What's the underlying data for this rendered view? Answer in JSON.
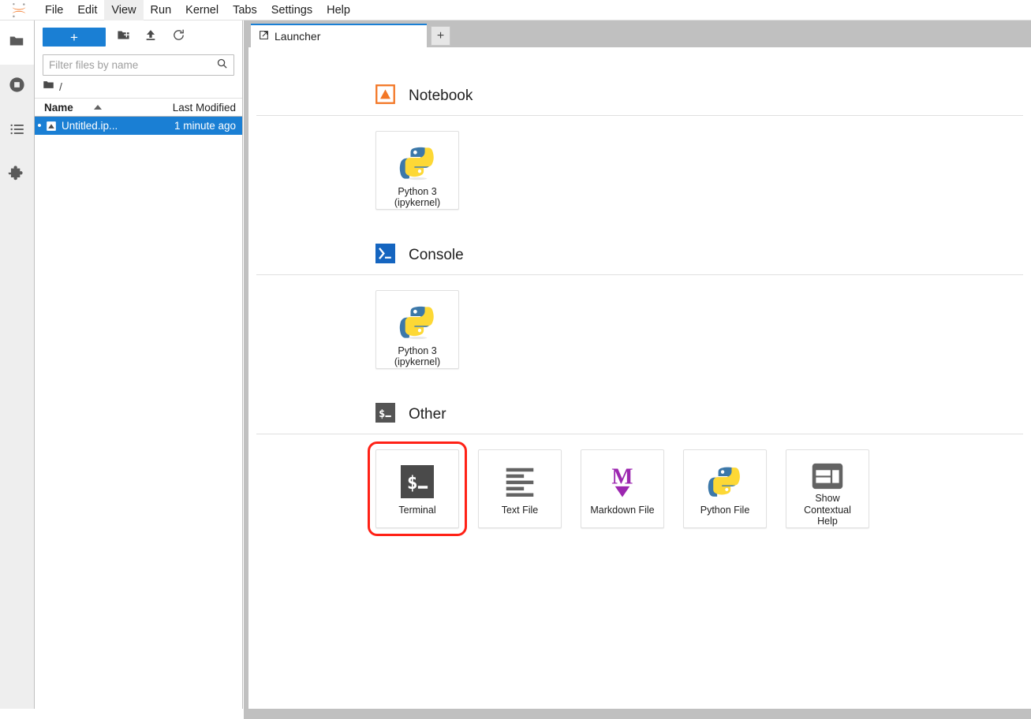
{
  "app": {
    "logo_icon": "jupyter-logo",
    "accent_blue": "#1a7fd4",
    "highlight_red": "#ff2116"
  },
  "menubar": {
    "items": [
      {
        "label": "File",
        "active": false
      },
      {
        "label": "Edit",
        "active": false
      },
      {
        "label": "View",
        "active": true
      },
      {
        "label": "Run",
        "active": false
      },
      {
        "label": "Kernel",
        "active": false
      },
      {
        "label": "Tabs",
        "active": false
      },
      {
        "label": "Settings",
        "active": false
      },
      {
        "label": "Help",
        "active": false
      }
    ]
  },
  "activitybar": {
    "items": [
      {
        "name": "file-browser",
        "icon": "folder-icon",
        "selected": true
      },
      {
        "name": "running-terminals-kernels",
        "icon": "stop-circle-icon",
        "selected": false
      },
      {
        "name": "table-of-contents",
        "icon": "list-icon",
        "selected": false
      },
      {
        "name": "extension-manager",
        "icon": "puzzle-icon",
        "selected": false
      }
    ]
  },
  "filebrowser": {
    "toolbar": {
      "new_launcher_label": "+",
      "new_folder_icon": "new-folder-icon",
      "upload_icon": "upload-icon",
      "refresh_icon": "refresh-icon"
    },
    "filter": {
      "placeholder": "Filter files by name",
      "value": "",
      "icon": "search-icon"
    },
    "breadcrumb": {
      "home_icon": "folder-icon",
      "path": "/"
    },
    "columns": [
      "Name",
      "Last Modified"
    ],
    "sort": {
      "column": "Name",
      "direction": "ascending",
      "icon": "caret-up-icon"
    },
    "rows": [
      {
        "name": "Untitled.ip...",
        "modified": "1 minute ago",
        "icon": "notebook-icon",
        "selected": true,
        "unsaved_dot": "•"
      }
    ]
  },
  "main": {
    "tabs": [
      {
        "label": "Launcher",
        "icon": "launcher-icon",
        "active": true
      }
    ],
    "add_tab_label": "+"
  },
  "launcher": {
    "sections": [
      {
        "title": "Notebook",
        "icon": "notebook-section-icon",
        "cards": [
          {
            "label": "Python 3\n(ipykernel)",
            "label_lines": [
              "Python 3",
              "(ipykernel)"
            ],
            "icon": "python-logo-icon",
            "highlighted": false
          }
        ]
      },
      {
        "title": "Console",
        "icon": "console-section-icon",
        "cards": [
          {
            "label": "Python 3\n(ipykernel)",
            "label_lines": [
              "Python 3",
              "(ipykernel)"
            ],
            "icon": "python-logo-icon",
            "highlighted": false
          }
        ]
      },
      {
        "title": "Other",
        "icon": "terminal-section-icon",
        "cards": [
          {
            "label": "Terminal",
            "label_lines": [
              "Terminal"
            ],
            "icon": "terminal-icon",
            "highlighted": true
          },
          {
            "label": "Text File",
            "label_lines": [
              "Text File"
            ],
            "icon": "text-file-icon",
            "highlighted": false
          },
          {
            "label": "Markdown File",
            "label_lines": [
              "Markdown File"
            ],
            "icon": "markdown-icon",
            "highlighted": false
          },
          {
            "label": "Python File",
            "label_lines": [
              "Python File"
            ],
            "icon": "python-logo-icon",
            "highlighted": false
          },
          {
            "label": "Show Contextual Help",
            "label_lines": [
              "Show",
              "Contextual",
              "Help"
            ],
            "icon": "contextual-help-icon",
            "highlighted": false
          }
        ]
      }
    ]
  }
}
